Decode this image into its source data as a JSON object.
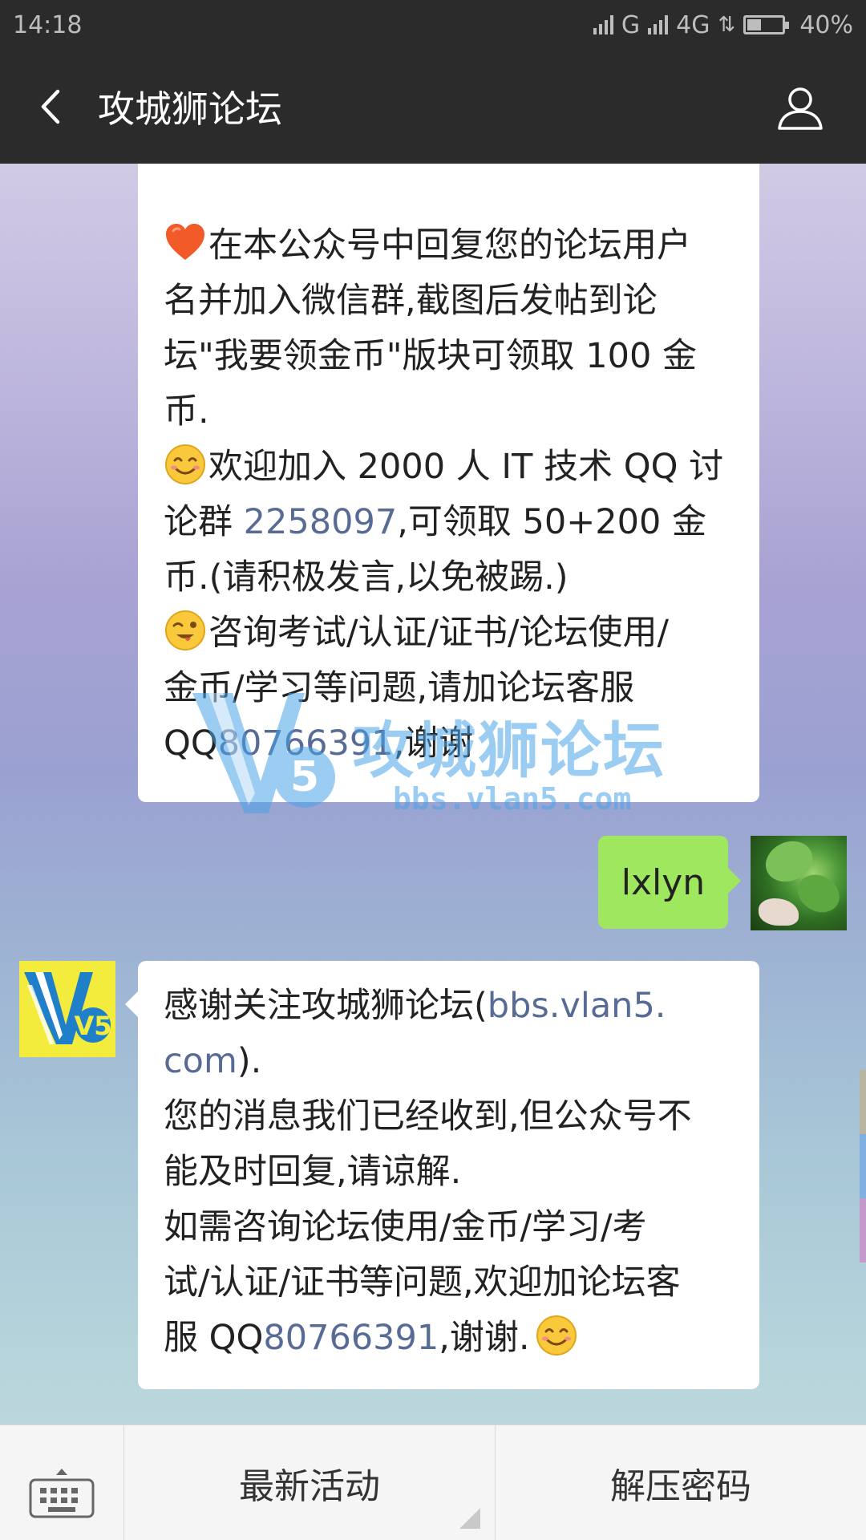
{
  "status_bar": {
    "time": "14:18",
    "network": "G",
    "network_4g": "4G",
    "battery": "40%",
    "battery_level": 0.4
  },
  "header": {
    "title": "攻城狮论坛"
  },
  "messages": {
    "first": {
      "lines": [
        "在本公众号中回复您的论坛用户",
        "名并加入微信群,截图后发帖到论",
        "坛\"我要领金币\"版块可领取 100 金",
        "币."
      ],
      "line5_pre": "欢迎加入 2000 人 IT 技术 QQ 讨",
      "line6_pre": "论群 ",
      "line6_link": "2258097",
      "line6_post": ",可领取 50+200 金",
      "line7": "币.(请积极发言,以免被踢.)",
      "line8": "咨询考试/认证/证书/论坛使用/",
      "line9": "金币/学习等问题,请加论坛客服",
      "line10_pre": "QQ",
      "line10_link": "80766391",
      "line10_post": ",谢谢"
    },
    "mine": {
      "text": "lxlyn"
    },
    "reply": {
      "line1_pre": "感谢关注攻城狮论坛(",
      "line1_link": "bbs.vlan5.",
      "line2_link": "com",
      "line2_post": ").",
      "line3": "您的消息我们已经收到,但公众号不",
      "line4": "能及时回复,请谅解.",
      "line5": "如需咨询论坛使用/金币/学习/考",
      "line6": "试/认证/证书等问题,欢迎加论坛客",
      "line7_pre": "服 QQ",
      "line7_link": "80766391",
      "line7_post": ",谢谢."
    }
  },
  "watermark": {
    "name": "攻城狮论坛",
    "url": "bbs.vlan5.com"
  },
  "bot_avatar": {
    "logo_text": "V5"
  },
  "bottom_menu": {
    "item1": "最新活动",
    "item2": "解压密码"
  },
  "colors": {
    "link": "#576b95",
    "my_bubble": "#9fe75e",
    "title_bar": "#2b2b2b"
  }
}
